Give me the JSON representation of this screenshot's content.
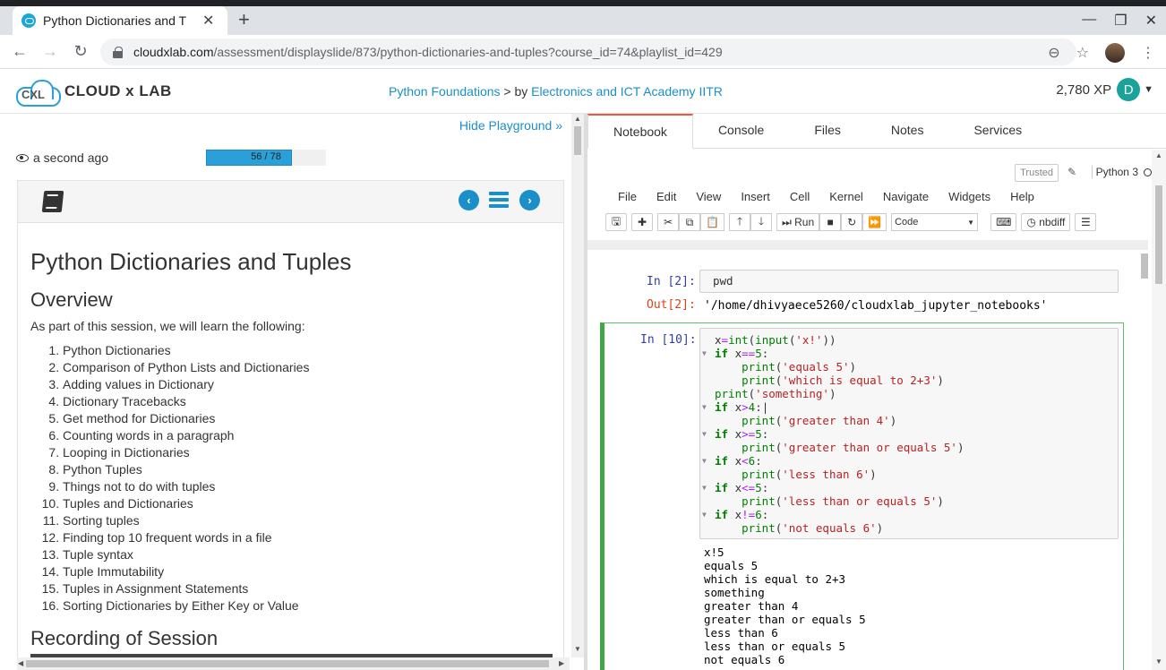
{
  "browser": {
    "tab_title": "Python Dictionaries and T",
    "url_host": "cloudxlab.com",
    "url_path": "/assessment/displayslide/873/python-dictionaries-and-tuples?course_id=74&playlist_id=429"
  },
  "site": {
    "logo_mark": "CXL",
    "brand": "CLOUD x LAB",
    "course_link": "Python Foundations",
    "by_text": " > by ",
    "provider_link": "Electronics and ICT Academy IITR",
    "xp": "2,780 XP",
    "avatar_letter": "D"
  },
  "left": {
    "hide_playground": "Hide Playground »",
    "seen": "a second ago",
    "progress_text": "56 / 78",
    "progress_fraction": 0.718,
    "title": "Python Dictionaries and Tuples",
    "overview_heading": "Overview",
    "intro": "As part of this session, we will learn the following:",
    "items": [
      "Python Dictionaries",
      "Comparison of Python Lists and Dictionaries",
      "Adding values in Dictionary",
      "Dictionary Tracebacks",
      "Get method for Dictionaries",
      "Counting words in a paragraph",
      "Looping in Dictionaries",
      "Python Tuples",
      "Things not to do with tuples",
      "Tuples and Dictionaries",
      "Sorting tuples",
      "Finding top 10 frequent words in a file",
      "Tuple syntax",
      "Tuple Immutability",
      "Tuples in Assignment Statements",
      "Sorting Dictionaries by Either Key or Value"
    ],
    "recording_heading": "Recording of Session"
  },
  "right": {
    "tabs": [
      "Notebook",
      "Console",
      "Files",
      "Notes",
      "Services"
    ],
    "trusted": "Trusted",
    "kernel": "Python 3",
    "menu": [
      "File",
      "Edit",
      "View",
      "Insert",
      "Cell",
      "Kernel",
      "Navigate",
      "Widgets",
      "Help"
    ],
    "run_label": "Run",
    "cell_type": "Code",
    "nbdiff_label": "nbdiff",
    "cell1": {
      "in_prompt": "In [2]:",
      "code": "pwd",
      "out_prompt": "Out[2]:",
      "output": "'/home/dhivyaece5260/cloudxlab_jupyter_notebooks'"
    },
    "cell2": {
      "in_prompt": "In [10]:",
      "output_lines": [
        "x!5",
        "equals 5",
        "which is equal to 2+3",
        "something",
        "greater than 4",
        "greater than or equals 5",
        "less than 6",
        "less than or equals 5",
        "not equals 6"
      ]
    }
  }
}
